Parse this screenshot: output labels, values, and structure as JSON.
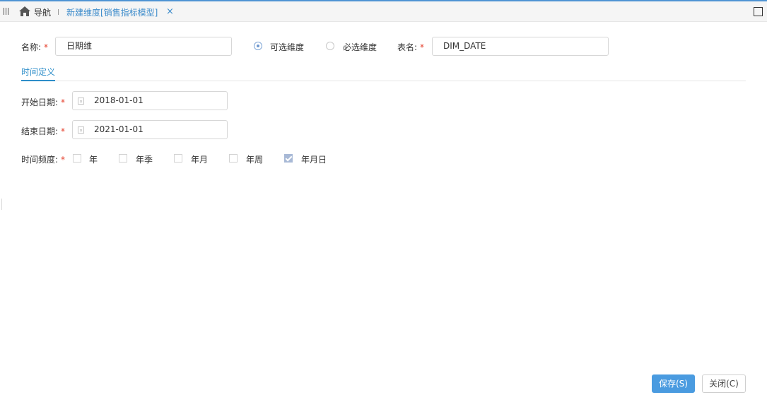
{
  "topbar": {
    "nav_label": "导航",
    "tab_title": "新建维度[销售指标模型]",
    "close_glyph": "×"
  },
  "form": {
    "name_label": "名称:",
    "name_value": "日期维",
    "optional_label": "可选维度",
    "required_label": "必选维度",
    "dimension_type_selected": "可选维度",
    "table_label": "表名:",
    "table_value": "DIM_DATE",
    "required_mark": "*"
  },
  "section": {
    "tab_label": "时间定义"
  },
  "time_def": {
    "start_label": "开始日期:",
    "start_value": "2018-01-01",
    "end_label": "结束日期:",
    "end_value": "2021-01-01",
    "freq_label": "时间频度:",
    "frequencies": [
      {
        "label": "年",
        "checked": false
      },
      {
        "label": "年季",
        "checked": false
      },
      {
        "label": "年月",
        "checked": false
      },
      {
        "label": "年周",
        "checked": false
      },
      {
        "label": "年月日",
        "checked": true
      }
    ]
  },
  "footer": {
    "save_label": "保存(S)",
    "close_label": "关闭(C)"
  },
  "colors": {
    "accent": "#4a9be0",
    "tab_text": "#3d8ccb",
    "required": "#e5412d",
    "checked_box": "#a8b9d6"
  }
}
